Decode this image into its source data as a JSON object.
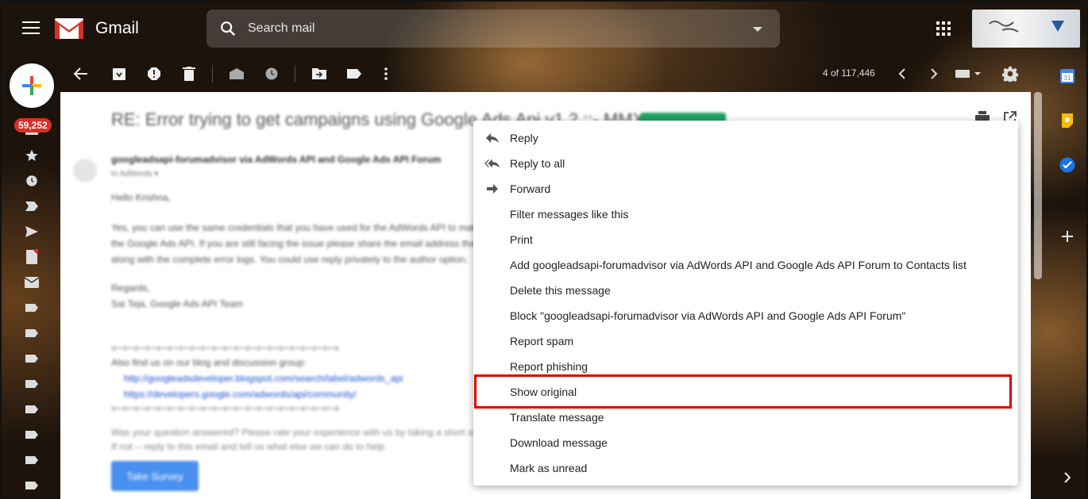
{
  "header": {
    "app_name": "Gmail",
    "search_placeholder": "Search mail"
  },
  "left_rail": {
    "inbox_count": "59,252"
  },
  "toolbar": {
    "page_count": "4 of 117,446"
  },
  "message": {
    "subject": "RE: Error trying to get campaigns using Google Ads Api v1.2 ::- MMX",
    "sender": "googleadsapi-forumadvisor via AdWords API and Google Ads API Forum",
    "to_line": "to AdWords ▾",
    "greeting": "Hello Krishna,",
    "body_lines": [
      "Yes, you can use the same credentials that you have used for the AdWords API to make calls to",
      "the Google Ads API. If you are still facing the issue please share the email address that you use",
      "along with the complete error logs. You could use reply privately to the author option."
    ],
    "signoff": [
      "Regards,",
      "Sai Teja, Google Ads API Team"
    ],
    "divider": "=~=~=~=~=~=~=~=~=~=~=~=~=~=~=~=~=~=~=~=~=",
    "find_us": "Also find us on our blog and discussion group:",
    "links": [
      "http://googleadsdeveloper.blogspot.com/search/label/adwords_api",
      "https://developers.google.com/adwords/api/community/"
    ],
    "survey_text": "Was your question answered? Please rate your experience with us by taking a short survey.",
    "survey_text2": "If not -- reply to this email and tell us what else we can do to help.",
    "survey_button": "Take Survey"
  },
  "menu": {
    "items": [
      {
        "label": "Reply",
        "icon": "reply-icon"
      },
      {
        "label": "Reply to all",
        "icon": "reply-all-icon"
      },
      {
        "label": "Forward",
        "icon": "forward-icon"
      },
      {
        "label": "Filter messages like this",
        "icon": ""
      },
      {
        "label": "Print",
        "icon": ""
      },
      {
        "label": "Add googleadsapi-forumadvisor via AdWords API and Google Ads API Forum to Contacts list",
        "icon": ""
      },
      {
        "label": "Delete this message",
        "icon": ""
      },
      {
        "label": "Block \"googleadsapi-forumadvisor via AdWords API and Google Ads API Forum\"",
        "icon": ""
      },
      {
        "label": "Report spam",
        "icon": ""
      },
      {
        "label": "Report phishing",
        "icon": ""
      },
      {
        "label": "Show original",
        "icon": ""
      },
      {
        "label": "Translate message",
        "icon": ""
      },
      {
        "label": "Download message",
        "icon": ""
      },
      {
        "label": "Mark as unread",
        "icon": ""
      }
    ],
    "highlighted": "Show original",
    "highlight_color": "#e00000"
  },
  "side_panel": {
    "calendar_day": "31"
  }
}
